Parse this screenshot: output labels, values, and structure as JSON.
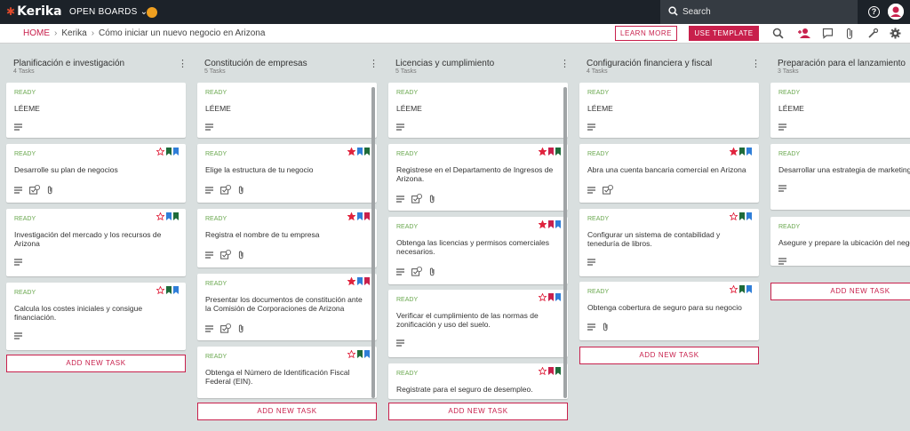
{
  "topbar": {
    "logo": "Kerika",
    "open_boards": "OPEN BOARDS",
    "search_placeholder": "Search",
    "help": "?"
  },
  "breadcrumb": {
    "home": "HOME",
    "org": "Kerika",
    "board": "Cómo iniciar un nuevo negocio en Arizona"
  },
  "buttons": {
    "learn_more": "LEARN MORE",
    "use_template": "USE TEMPLATE",
    "add_task": "ADD NEW TASK"
  },
  "colors": {
    "accent": "#c8204c",
    "ready": "#6aa84f",
    "topbar": "#1c2229"
  },
  "columns": [
    {
      "title": "Planificación e investigación",
      "count": "4 Tasks",
      "cards": [
        {
          "status": "READY",
          "title": "LÉEME"
        },
        {
          "status": "READY",
          "title": "Desarrolle su plan de negocios",
          "sub": "4"
        },
        {
          "status": "READY",
          "title": "Investigación del mercado y los recursos de Arizona"
        },
        {
          "status": "READY",
          "title": "Calcula los costes iniciales y consigue financiación."
        }
      ]
    },
    {
      "title": "Constitución de empresas",
      "count": "5 Tasks",
      "cards": [
        {
          "status": "READY",
          "title": "LÉEME"
        },
        {
          "status": "READY",
          "title": "Elige la estructura de tu negocio",
          "sub": "4"
        },
        {
          "status": "READY",
          "title": "Registra el nombre de tu empresa",
          "sub": "3"
        },
        {
          "status": "READY",
          "title": "Presentar los documentos de constitución ante la Comisión de Corporaciones de Arizona",
          "sub": "3"
        },
        {
          "status": "READY",
          "title": "Obtenga el Número de Identificación Fiscal Federal (EIN)."
        }
      ]
    },
    {
      "title": "Licencias y cumplimiento",
      "count": "5 Tasks",
      "cards": [
        {
          "status": "READY",
          "title": "LÉEME"
        },
        {
          "status": "READY",
          "title": "Registrese en el Departamento de Ingresos de Arizona.",
          "sub": "4"
        },
        {
          "status": "READY",
          "title": "Obtenga las licencias y permisos comerciales necesarios.",
          "sub": "3"
        },
        {
          "status": "READY",
          "title": "Verificar el cumplimiento de las normas de zonificación y uso del suelo."
        },
        {
          "status": "READY",
          "title": "Registrate para el seguro de desempleo."
        }
      ]
    },
    {
      "title": "Configuración financiera y fiscal",
      "count": "4 Tasks",
      "cards": [
        {
          "status": "READY",
          "title": "LÉEME"
        },
        {
          "status": "READY",
          "title": "Abra una cuenta bancaria comercial en Arizona",
          "sub": "4"
        },
        {
          "status": "READY",
          "title": "Configurar un sistema de contabilidad y teneduría de libros."
        },
        {
          "status": "READY",
          "title": "Obtenga cobertura de seguro para su negocio"
        }
      ]
    },
    {
      "title": "Preparación para el lanzamiento",
      "count": "3 Tasks",
      "cards": [
        {
          "status": "READY",
          "title": "LÉEME"
        },
        {
          "status": "READY",
          "title": "Desarrollar una estrategia de marketing y marca."
        },
        {
          "status": "READY",
          "title": "Asegure y prepare la ubicación del negocio."
        }
      ]
    }
  ]
}
